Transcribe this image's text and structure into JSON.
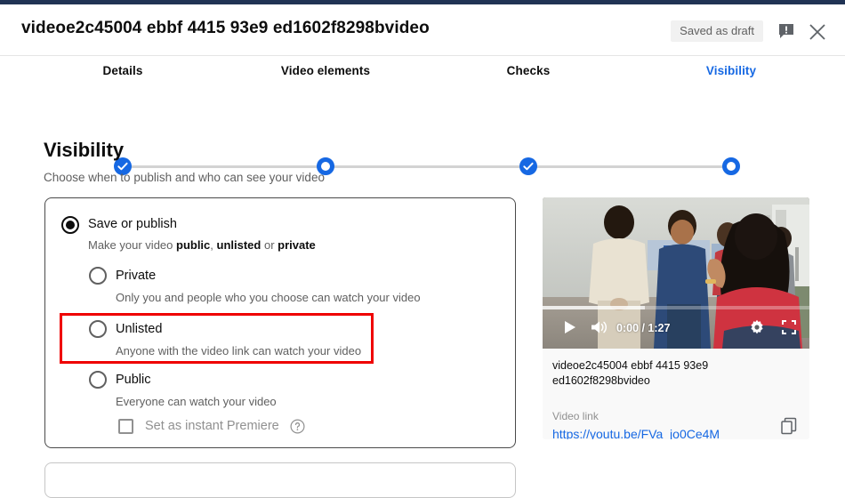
{
  "header": {
    "title": "videoe2c45004 ebbf 4415 93e9 ed1602f8298bvideo",
    "saved_status": "Saved as draft",
    "feedback_icon": "feedback-exclamation-icon",
    "close_icon": "close-x-icon"
  },
  "stepper": {
    "steps": [
      {
        "label": "Details",
        "state": "done"
      },
      {
        "label": "Video elements",
        "state": "ring"
      },
      {
        "label": "Checks",
        "state": "done"
      },
      {
        "label": "Visibility",
        "state": "ring",
        "active": true
      }
    ]
  },
  "section": {
    "title": "Visibility",
    "subtitle": "Choose when to publish and who can see your video"
  },
  "options": {
    "save_or_publish": {
      "label": "Save or publish",
      "desc_pre": "Make your video ",
      "desc_b1": "public",
      "desc_mid1": ", ",
      "desc_b2": "unlisted",
      "desc_mid2": " or ",
      "desc_b3": "private",
      "selected": true
    },
    "private": {
      "label": "Private",
      "desc": "Only you and people who you choose can watch your video",
      "selected": false
    },
    "unlisted": {
      "label": "Unlisted",
      "desc": "Anyone with the video link can watch your video",
      "selected": false,
      "highlighted": true
    },
    "public": {
      "label": "Public",
      "desc": "Everyone can watch your video",
      "selected": false
    },
    "premiere": {
      "label": "Set as instant Premiere",
      "checked": false,
      "help_icon": "help-question-icon"
    }
  },
  "preview": {
    "player": {
      "play_icon": "play-icon",
      "volume_icon": "volume-icon",
      "time": "0:00 / 1:27",
      "settings_icon": "gear-icon",
      "fullscreen_icon": "fullscreen-icon"
    },
    "video_title": "videoe2c45004 ebbf 4415 93e9 ed1602f8298bvideo",
    "link_label": "Video link",
    "link_url": "https://youtu.be/FVa_jo0Ce4M",
    "copy_icon": "copy-icon"
  },
  "colors": {
    "accent_blue": "#1668e3",
    "annotation_red": "#ef0000",
    "link_blue": "#1668e3",
    "progress_red": "#ff0000"
  }
}
